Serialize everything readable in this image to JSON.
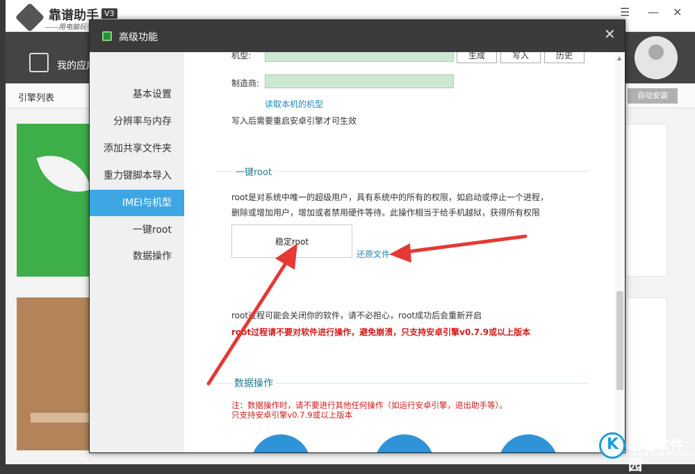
{
  "background_app": {
    "logo_text": "靠谱助手",
    "logo_subtitle": "——用电脑玩手",
    "version_badge": "V3",
    "window_controls": [
      "☰",
      "—",
      "✕"
    ],
    "nav_label": "我的应用",
    "tab_label": "引擎列表",
    "auto_install_button": "自动安装"
  },
  "dialog": {
    "title": "高级功能",
    "close_glyph": "✕",
    "sidebar": {
      "items": [
        {
          "label": "基本设置",
          "active": false
        },
        {
          "label": "分辨率与内存",
          "active": false
        },
        {
          "label": "添加共享文件夹",
          "active": false
        },
        {
          "label": "重力键脚本导入",
          "active": false
        },
        {
          "label": "IMEI与机型",
          "active": true
        },
        {
          "label": "一键root",
          "active": false
        },
        {
          "label": "数据操作",
          "active": false
        }
      ]
    },
    "imei_section": {
      "model_label": "机型:",
      "model_value": "",
      "generate_button": "生成",
      "write_button": "写入",
      "history_button": "历史",
      "manufacturer_label": "制造商:",
      "manufacturer_value": "",
      "read_model_link": "读取本机的机型",
      "note": "写入后需要重启安卓引擎才可生效"
    },
    "root_section": {
      "title": "一键root",
      "desc_line1": "root是对系统中唯一的超级用户，具有系统中的所有的权限，如启动或停止一个进程，",
      "desc_line2": "删除或增加用户，增加或者禁用硬件等待。此操作相当于给手机越狱，获得所有权限",
      "stable_root_button": "稳定root",
      "restore_link": "还原文件",
      "info": "root过程可能会关闭你的软件，请不必担心，root成功后会重新开启",
      "warning": "root过程请不要对软件进行操作，避免崩溃，只支持安卓引擎v0.7.9或以上版本"
    },
    "data_section": {
      "title": "数据操作",
      "note_line1": "注：数据操作时，请不要进行其他任何操作（如运行安卓引擎，退出助手等）。",
      "note_line2": "只支持安卓引擎v0.7.9或以上版本"
    }
  },
  "watermark": {
    "logo_letter": "K",
    "text": "当客软件园",
    "url": "www.downkr.com"
  },
  "colors": {
    "accent": "#3fa6e4",
    "title_bar": "#3b3b3b",
    "input_bg": "#cfe8d3",
    "warning_red": "#d21a1a",
    "link": "#1e8ab7",
    "annotation_arrow": "#e53935"
  }
}
